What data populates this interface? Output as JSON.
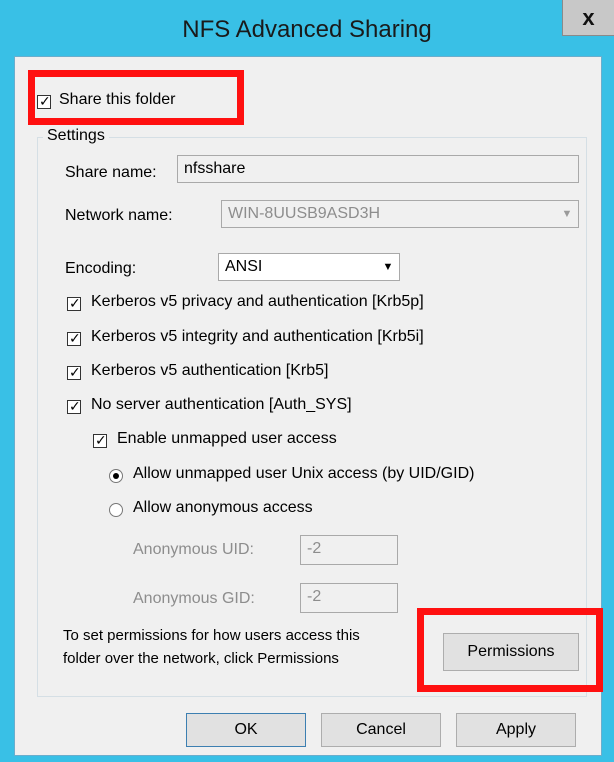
{
  "window": {
    "title": "NFS Advanced Sharing",
    "close_label": "x"
  },
  "share_this_folder": {
    "label": "Share this folder",
    "checked": true
  },
  "settings": {
    "group_label": "Settings",
    "share_name": {
      "label": "Share name:",
      "value": "nfsshare"
    },
    "network_name": {
      "label": "Network name:",
      "value": "WIN-8UUSB9ASD3H"
    },
    "encoding": {
      "label": "Encoding:",
      "value": "ANSI"
    },
    "auth_options": [
      {
        "label": "Kerberos v5 privacy and authentication [Krb5p]",
        "checked": true
      },
      {
        "label": "Kerberos v5 integrity and authentication [Krb5i]",
        "checked": true
      },
      {
        "label": "Kerberos v5 authentication [Krb5]",
        "checked": true
      },
      {
        "label": "No server authentication [Auth_SYS]",
        "checked": true
      }
    ],
    "enable_unmapped": {
      "label": "Enable unmapped user access",
      "checked": true
    },
    "radio_unix": {
      "label": "Allow unmapped user Unix access (by UID/GID)",
      "selected": true
    },
    "radio_anonymous": {
      "label": "Allow anonymous access",
      "selected": false
    },
    "anonymous_uid": {
      "label": "Anonymous UID:",
      "value": "-2"
    },
    "anonymous_gid": {
      "label": "Anonymous GID:",
      "value": "-2"
    },
    "permissions_text_line1": "To set permissions for how users access this",
    "permissions_text_line2": "folder over the network, click Permissions",
    "permissions_button": "Permissions"
  },
  "buttons": {
    "ok": "OK",
    "cancel": "Cancel",
    "apply": "Apply"
  },
  "colors": {
    "titlebar": "#39c0e6",
    "highlight": "#ff1010",
    "dialog_bg": "#f0f0f0"
  }
}
